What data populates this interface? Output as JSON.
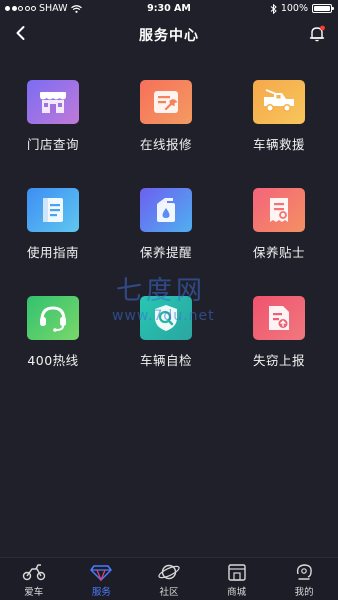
{
  "status_bar": {
    "carrier": "SHAW",
    "time": "9:30 AM",
    "battery": "100%"
  },
  "header": {
    "title": "服务中心"
  },
  "services": [
    {
      "label": "门店查询",
      "icon": "store-icon",
      "colors": [
        "#7b6cf3",
        "#c07ad8"
      ]
    },
    {
      "label": "在线报修",
      "icon": "repair-icon",
      "colors": [
        "#f7705a",
        "#f39b62"
      ]
    },
    {
      "label": "车辆救援",
      "icon": "tow-truck-icon",
      "colors": [
        "#f6a84b",
        "#f7c65b"
      ]
    },
    {
      "label": "使用指南",
      "icon": "guide-icon",
      "colors": [
        "#3e8ef2",
        "#5fc7f0"
      ]
    },
    {
      "label": "保养提醒",
      "icon": "oil-can-icon",
      "colors": [
        "#6d5ff0",
        "#4fb0f0"
      ]
    },
    {
      "label": "保养贴士",
      "icon": "receipt-icon",
      "colors": [
        "#f5637b",
        "#f39163"
      ]
    },
    {
      "label": "400热线",
      "icon": "headset-icon",
      "colors": [
        "#32c26f",
        "#79d86a"
      ]
    },
    {
      "label": "车辆自检",
      "icon": "shield-search-icon",
      "colors": [
        "#27c7b3",
        "#2aa6a0"
      ]
    },
    {
      "label": "失窃上报",
      "icon": "report-upload-icon",
      "colors": [
        "#f0536d",
        "#f0787f"
      ]
    }
  ],
  "watermark": {
    "cn": "七度网",
    "url": "www.7du.net"
  },
  "tabs": [
    {
      "label": "爱车",
      "icon": "scooter-icon",
      "active": false
    },
    {
      "label": "服务",
      "icon": "diamond-icon",
      "active": true
    },
    {
      "label": "社区",
      "icon": "planet-icon",
      "active": false
    },
    {
      "label": "商城",
      "icon": "shop-icon",
      "active": false
    },
    {
      "label": "我的",
      "icon": "profile-icon",
      "active": false
    }
  ],
  "colors": {
    "background": "#20202b",
    "accent": "#4d7bff",
    "notification_dot": "#ff3b30"
  }
}
